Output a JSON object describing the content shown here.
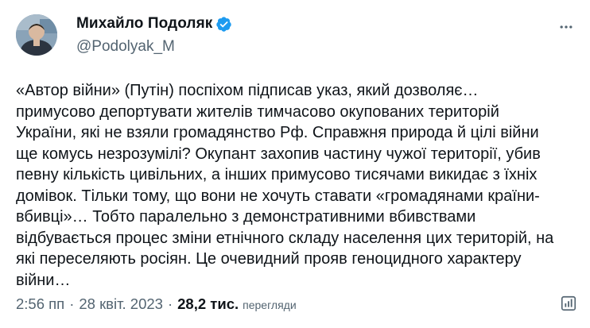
{
  "author": {
    "display_name": "Михайло Подоляк",
    "handle": "@Podolyak_M",
    "verified": true
  },
  "tweet": {
    "text": "«Автор війни» (Путін) поспіхом підписав указ, який дозволяє…\nпримусово депортувати жителів тимчасово окупованих територій\nУкраїни, які не взяли громадянство Рф. Справжня природа й цілі війни\nще комусь незрозумілі? Окупант захопив частину чужої території, убив\nпевну кількість цивільних, а інших примусово тисячами викидає з їхніх\nдомівок. Тільки тому, що вони не хочуть ставати «громадянами країни-\nвбивці»… Тобто паралельно з демонстративними вбивствами\nвідбувається процес зміни етнічного складу населення цих територій, на\nякі переселяють росіян. Це очевидний прояв геноцидного характеру\nвійни…"
  },
  "meta": {
    "time": "2:56 пп",
    "separator": "·",
    "date": "28 квіт. 2023",
    "views_count": "28,2 тис.",
    "views_label": "перегляди"
  },
  "icons": {
    "verified": "verified-badge-icon",
    "more": "more-options-icon",
    "analytics": "analytics-icon"
  },
  "colors": {
    "text": "#0f1419",
    "secondary": "#536471",
    "verified": "#1d9bf0"
  }
}
